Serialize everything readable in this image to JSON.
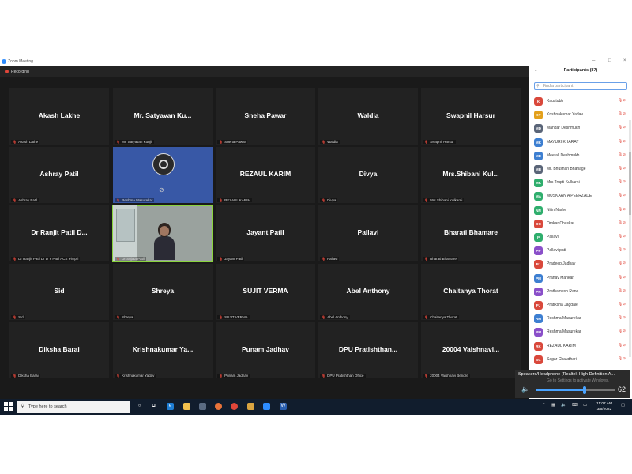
{
  "window": {
    "title": "Zoom Meeting",
    "recording_label": "Recording"
  },
  "tiles": [
    {
      "name": "Akash Lakhe",
      "label": "Akash Lathe"
    },
    {
      "name": "Mr. Satyavan Ku...",
      "label": "Mr. Satyavan Kunjir"
    },
    {
      "name": "Sneha Pawar",
      "label": "Sneha Pawar"
    },
    {
      "name": "Waldia",
      "label": "Waldia"
    },
    {
      "name": "Swapnil Harsur",
      "label": "Swapnil Harsur"
    },
    {
      "name": "Ashray Patil",
      "label": "Ashray Patil"
    },
    {
      "name": "",
      "label": "Reshma Masurekar"
    },
    {
      "name": "REZAUL KARIM",
      "label": "REZAUL KARIM"
    },
    {
      "name": "Divya",
      "label": "Divya"
    },
    {
      "name": "Mrs.Shibani Kul...",
      "label": "Mrs.Shibani Kulkarni"
    },
    {
      "name": "Dr Ranjit Patil D...",
      "label": "Dr Ranjit Patil Dr D Y Patil ACS Pimpri"
    },
    {
      "name": "",
      "label": "Dr Sujata Patil"
    },
    {
      "name": "Jayant Patil",
      "label": "Jayant Patil"
    },
    {
      "name": "Pallavi",
      "label": "Pallavi"
    },
    {
      "name": "Bharati Bhamare",
      "label": "Bharati Bhamare"
    },
    {
      "name": "Sid",
      "label": "Sid"
    },
    {
      "name": "Shreya",
      "label": "Shreya"
    },
    {
      "name": "SUJIT VERMA",
      "label": "SUJIT VERMA"
    },
    {
      "name": "Abel Anthony",
      "label": "Abel Anthony"
    },
    {
      "name": "Chaitanya Thorat",
      "label": "Chaitanya Thorat"
    },
    {
      "name": "Diksha Barai",
      "label": "Diksha Barai"
    },
    {
      "name": "Krishnakumar Ya...",
      "label": "Krishnakumar Yadav"
    },
    {
      "name": "Punam Jadhav",
      "label": "Punam Jadhav"
    },
    {
      "name": "DPU Pratishthan...",
      "label": "DPU Pratishthan Office"
    },
    {
      "name": "20004 Vaishnavi...",
      "label": "20004 Vaishnavi Bendre"
    }
  ],
  "participants_panel": {
    "title": "Participants (87)",
    "search_placeholder": "Find a participant",
    "participants": [
      {
        "initials": "K",
        "name": "Kaustubh",
        "color": "#d9483b"
      },
      {
        "initials": "KY",
        "name": "Krishnakumar Yadav",
        "color": "#e3a01b"
      },
      {
        "initials": "MD",
        "name": "Mandar Deshmukh",
        "color": "#5a6578"
      },
      {
        "initials": "MK",
        "name": "MAYURI KHARAT",
        "color": "#3d7fd1"
      },
      {
        "initials": "MD",
        "name": "Meetali Deshmukh",
        "color": "#3d7fd1"
      },
      {
        "initials": "MB",
        "name": "Mr. Bhushan Bhanage",
        "color": "#5a6578"
      },
      {
        "initials": "MK",
        "name": "Mrs Trupti Kulkarni",
        "color": "#2fae6d"
      },
      {
        "initials": "MA",
        "name": "MUSKAAN A PEERZADE",
        "color": "#2fae6d"
      },
      {
        "initials": "NN",
        "name": "Nitin Narhe",
        "color": "#2fae6d"
      },
      {
        "initials": "OC",
        "name": "Omkar Chaskar",
        "color": "#d9483b"
      },
      {
        "initials": "P",
        "name": "Pallavi",
        "color": "#2fae6d"
      },
      {
        "initials": "PP",
        "name": "Pallavi patil",
        "color": "#8a4fc9"
      },
      {
        "initials": "PJ",
        "name": "Pradeep Jadhav",
        "color": "#d9483b"
      },
      {
        "initials": "PM",
        "name": "Pranav Mankar",
        "color": "#3d7fd1"
      },
      {
        "initials": "PR",
        "name": "Prathamesh Rane",
        "color": "#8a4fc9"
      },
      {
        "initials": "PJ",
        "name": "Pratiksha Jagdale",
        "color": "#d9483b"
      },
      {
        "initials": "RM",
        "name": "Reshma Masurekar",
        "color": "#3d7fd1"
      },
      {
        "initials": "RM",
        "name": "Reshma Masurekar",
        "color": "#8a4fc9"
      },
      {
        "initials": "RK",
        "name": "REZAUL KARIM",
        "color": "#d9483b"
      },
      {
        "initials": "SC",
        "name": "Sagar Chaudhari",
        "color": "#d9483b"
      }
    ]
  },
  "volume_popup": {
    "device": "Speakers/Headphone (Realtek High Definition A...",
    "activation_hint": "Go to Settings to activate Windows.",
    "value": "62",
    "level_percent": 62
  },
  "taskbar": {
    "search_placeholder": "Type here to search",
    "time": "11:07 AM",
    "date": "3/5/2022"
  }
}
